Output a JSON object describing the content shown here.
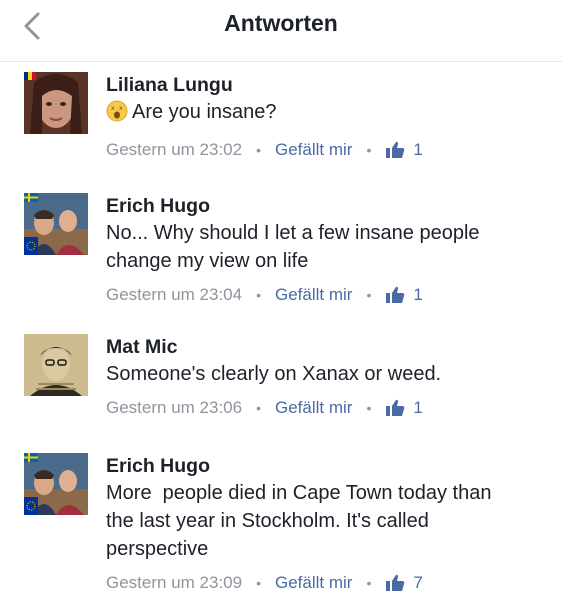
{
  "header": {
    "title": "Antworten",
    "back_icon": "chevron-left-icon"
  },
  "colors": {
    "meta": "#90949c",
    "link": "#4b6aa5",
    "text": "#1d2129"
  },
  "comments": [
    {
      "author": "Liliana Lungu",
      "emoji": "astonished-face-emoji",
      "text": "Are you insane?",
      "time": "Gestern um 23:02",
      "like_label": "Gefällt mir",
      "like_count": "1",
      "flag": "romania-flag"
    },
    {
      "author": "Erich Hugo",
      "text_lines": [
        "No... Why should I let a few insane people",
        "change my view on life"
      ],
      "time": "Gestern um 23:04",
      "like_label": "Gefällt mir",
      "like_count": "1",
      "flag": "sweden-flag"
    },
    {
      "author": "Mat Mic",
      "text": "Someone's clearly on Xanax or weed.",
      "time": "Gestern um 23:06",
      "like_label": "Gefällt mir",
      "like_count": "1"
    },
    {
      "author": "Erich Hugo",
      "text_lines": [
        "More  people died in Cape Town today than",
        "the last year in Stockholm. It's called",
        "perspective"
      ],
      "time": "Gestern um 23:09",
      "like_label": "Gefällt mir",
      "like_count": "7",
      "flag": "sweden-flag"
    }
  ]
}
